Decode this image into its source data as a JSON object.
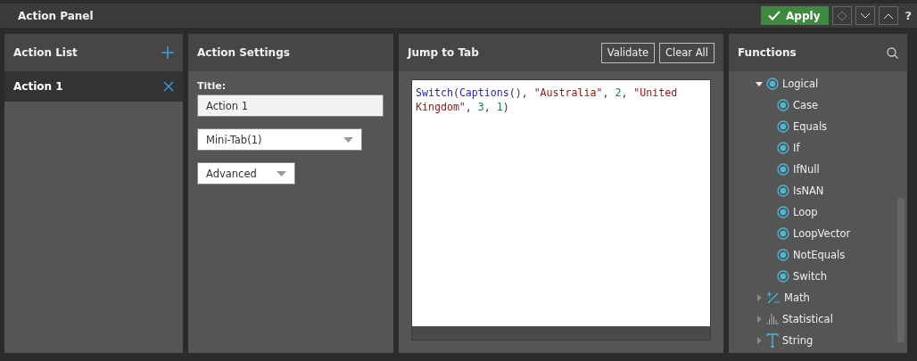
{
  "window": {
    "title": "Action Panel"
  },
  "toolbar": {
    "apply": "Apply",
    "help": "?"
  },
  "action_list": {
    "title": "Action List",
    "items": [
      {
        "label": "Action 1",
        "selected": true
      }
    ]
  },
  "action_settings": {
    "title": "Action Settings",
    "title_label": "Title:",
    "title_value": "Action 1",
    "dropdowns": [
      "Mini-Tab(1)",
      "Advanced"
    ]
  },
  "jump_to_tab": {
    "title": "Jump to Tab",
    "buttons": [
      "Validate",
      "Clear All"
    ],
    "code": [
      {
        "kind": "func",
        "text": "Switch"
      },
      {
        "kind": "punct",
        "text": "("
      },
      {
        "kind": "func",
        "text": "Captions"
      },
      {
        "kind": "punct",
        "text": "(), "
      },
      {
        "kind": "string",
        "text": "\"Australia\""
      },
      {
        "kind": "punct",
        "text": ", "
      },
      {
        "kind": "number",
        "text": "2"
      },
      {
        "kind": "punct",
        "text": ", "
      },
      {
        "kind": "string",
        "text": "\"United Kingdom\""
      },
      {
        "kind": "punct",
        "text": ", "
      },
      {
        "kind": "number",
        "text": "3"
      },
      {
        "kind": "punct",
        "text": ", "
      },
      {
        "kind": "number",
        "text": "1"
      },
      {
        "kind": "punct",
        "text": ")"
      }
    ]
  },
  "functions": {
    "title": "Functions",
    "tree": [
      {
        "label": "Logical",
        "kind": "circle",
        "expanded": true,
        "children": [
          {
            "label": "Case",
            "kind": "circle"
          },
          {
            "label": "Equals",
            "kind": "circle"
          },
          {
            "label": "If",
            "kind": "circle"
          },
          {
            "label": "IfNull",
            "kind": "circle"
          },
          {
            "label": "IsNAN",
            "kind": "circle"
          },
          {
            "label": "Loop",
            "kind": "circle"
          },
          {
            "label": "LoopVector",
            "kind": "circle"
          },
          {
            "label": "NotEquals",
            "kind": "circle"
          },
          {
            "label": "Switch",
            "kind": "circle"
          }
        ]
      },
      {
        "label": "Math",
        "kind": "math",
        "expanded": false
      },
      {
        "label": "Statistical",
        "kind": "bars",
        "expanded": false
      },
      {
        "label": "String",
        "kind": "text",
        "expanded": false
      }
    ]
  }
}
